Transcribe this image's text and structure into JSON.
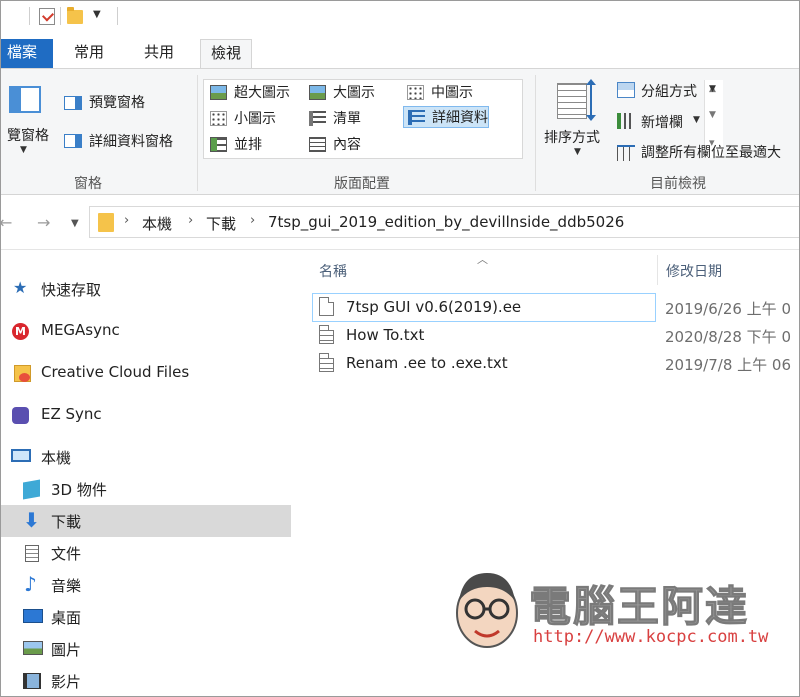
{
  "tabs": {
    "file": "檔案",
    "home": "常用",
    "share": "共用",
    "view": "檢視"
  },
  "ribbon": {
    "panes": {
      "nav_pane": "覽窗格",
      "preview_pane": "預覽窗格",
      "details_pane": "詳細資料窗格",
      "group_label": "窗格"
    },
    "layout": {
      "items": [
        "超大圖示",
        "大圖示",
        "中圖示",
        "小圖示",
        "清單",
        "詳細資料",
        "並排",
        "內容"
      ],
      "selected": "詳細資料",
      "group_label": "版面配置"
    },
    "current_view": {
      "sort_by": "排序方式",
      "group_by": "分組方式",
      "add_columns": "新增欄",
      "size_all_columns": "調整所有欄位至最適大",
      "group_label": "目前檢視"
    }
  },
  "address": {
    "crumbs": [
      "本機",
      "下載",
      "7tsp_gui_2019_edition_by_devillnside_ddb5026"
    ]
  },
  "sidebar": {
    "items": [
      {
        "label": "快速存取",
        "icon": "star-icon"
      },
      {
        "label": "MEGAsync",
        "icon": "mega-icon"
      },
      {
        "label": "Creative Cloud Files",
        "icon": "creative-cloud-icon"
      },
      {
        "label": "EZ Sync",
        "icon": "ez-sync-icon"
      },
      {
        "label": "本機",
        "icon": "computer-icon"
      },
      {
        "label": "3D 物件",
        "icon": "cube-3d-icon"
      },
      {
        "label": "下載",
        "icon": "download-icon",
        "selected": true
      },
      {
        "label": "文件",
        "icon": "document-icon"
      },
      {
        "label": "音樂",
        "icon": "music-icon"
      },
      {
        "label": "桌面",
        "icon": "desktop-icon"
      },
      {
        "label": "圖片",
        "icon": "pictures-icon"
      },
      {
        "label": "影片",
        "icon": "videos-icon"
      }
    ]
  },
  "files": {
    "columns": {
      "name": "名稱",
      "modified": "修改日期"
    },
    "rows": [
      {
        "name": "7tsp GUI v0.6(2019).ee",
        "modified": "2019/6/26 上午 0",
        "icon": "file-icon"
      },
      {
        "name": "How To.txt",
        "modified": "2020/8/28 下午 0",
        "icon": "text-file-icon"
      },
      {
        "name": "Renam .ee to .exe.txt",
        "modified": "2019/7/8 上午 06",
        "icon": "text-file-icon"
      }
    ]
  },
  "watermark": {
    "title": "電腦王阿達",
    "url": "http://www.kocpc.com.tw"
  },
  "colors": {
    "accent": "#1f6cc3",
    "selection": "#cce4f7",
    "sidebar_selected": "#d9d9d9",
    "watermark_url": "#d84040"
  }
}
